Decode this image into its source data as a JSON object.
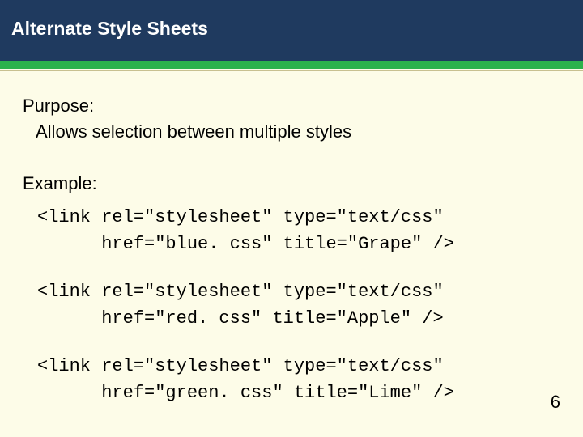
{
  "header": {
    "title": "Alternate Style Sheets"
  },
  "body": {
    "purpose_label": "Purpose:",
    "purpose_text": "Allows selection between multiple styles",
    "example_label": "Example:",
    "code1_line1": "<link rel=\"stylesheet\" type=\"text/css\"",
    "code1_line2": "      href=\"blue. css\" title=\"Grape\" />",
    "code2_line1": "<link rel=\"stylesheet\" type=\"text/css\"",
    "code2_line2": "      href=\"red. css\" title=\"Apple\" />",
    "code3_line1": "<link rel=\"stylesheet\" type=\"text/css\"",
    "code3_line2": "      href=\"green. css\" title=\"Lime\" />"
  },
  "footer": {
    "page_number": "6"
  }
}
